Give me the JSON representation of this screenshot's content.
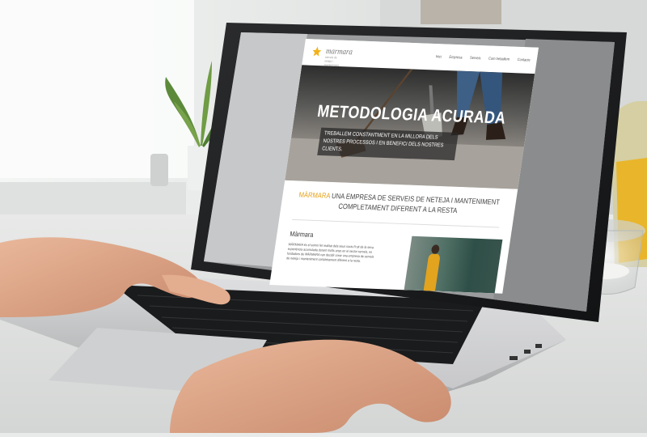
{
  "site": {
    "logo_text": "marmara",
    "logo_sub": "serveis de neteja i manteniment",
    "nav": [
      "Inici",
      "Empresa",
      "Serveis",
      "Com treballem",
      "Contacte"
    ],
    "hero_title": "METODOLOGIA ACURADA",
    "hero_text": "TREBALLEM CONSTANTMENT EN LA MILLORA DELS NOSTRES PROCESSOS I EN BENEFICI DELS NOSTRES CLIENTS.",
    "tagline_brand": "MÀRMARA",
    "tagline_rest": " UNA EMPRESA DE SERVEIS DE NETEJA I MANTENIMENT COMPLETAMENT DIFERENT A LA RESTA",
    "section_title": "Màrmara",
    "paragraph": "MÀRMARA és el somni fet realitat dels seus socis.Fruit de la seva experiència acumulada durant molts anys en el sector serveis, es fundadors de MÀRMARA van decidir crear una empresa de serveis de neteja i manteniment completament diferent a la resta."
  },
  "colors": {
    "accent": "#e6a21a",
    "hero_overlay": "#282828"
  }
}
